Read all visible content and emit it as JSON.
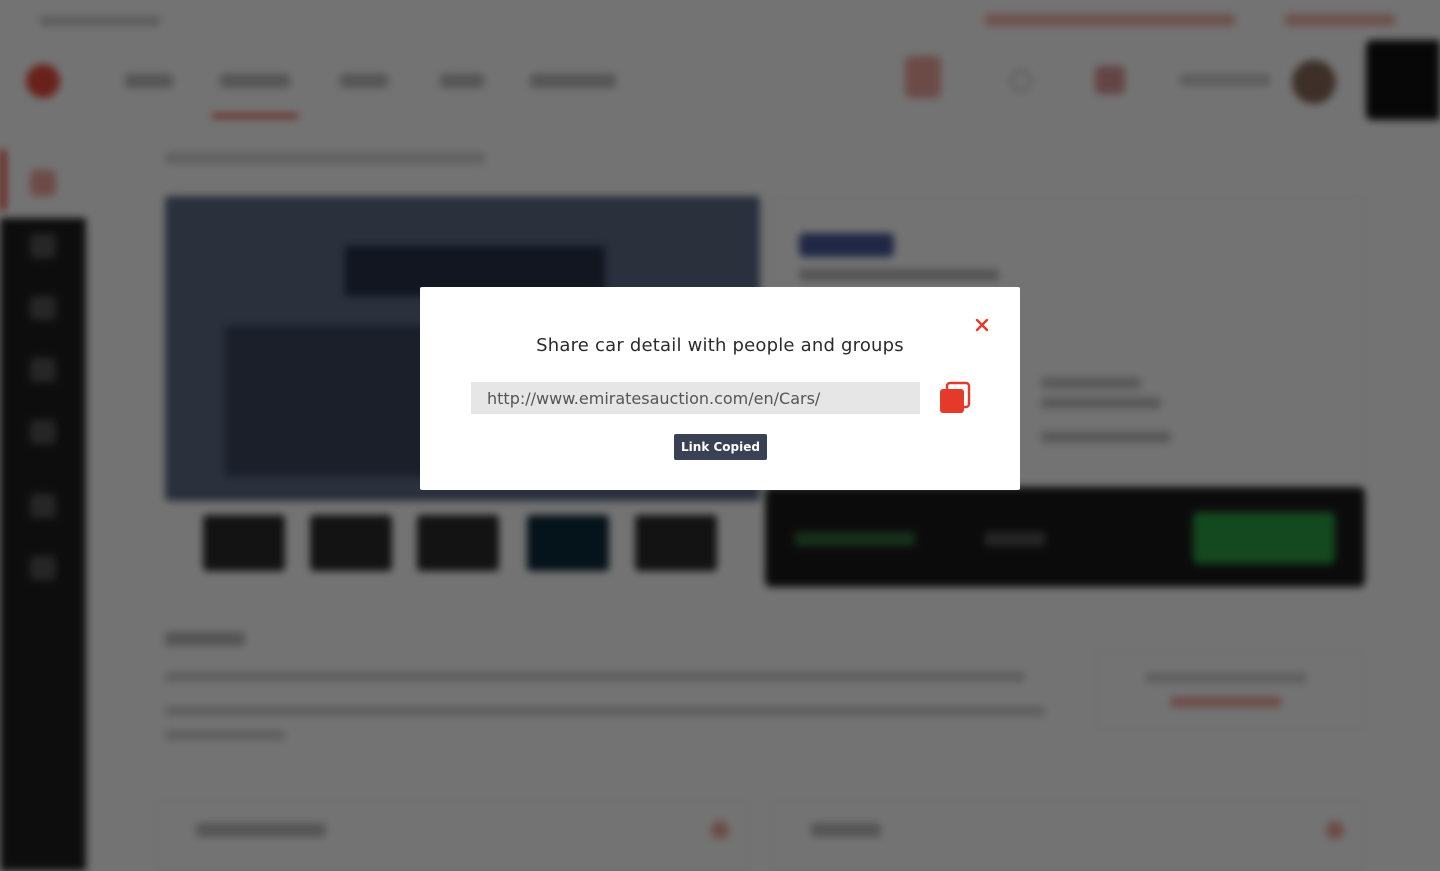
{
  "modal": {
    "title": "Share car detail with people and groups",
    "url_value": "http://www.emiratesauction.com/en/Cars/",
    "copied_label": "Link Copied",
    "close_icon": "close-icon",
    "copy_icon": "copy-icon"
  },
  "colors": {
    "accent": "#e53a2a",
    "badge_bg": "#3a4154",
    "field_bg": "#e6e6e6",
    "overlay": "rgba(0,0,0,0.55)"
  }
}
